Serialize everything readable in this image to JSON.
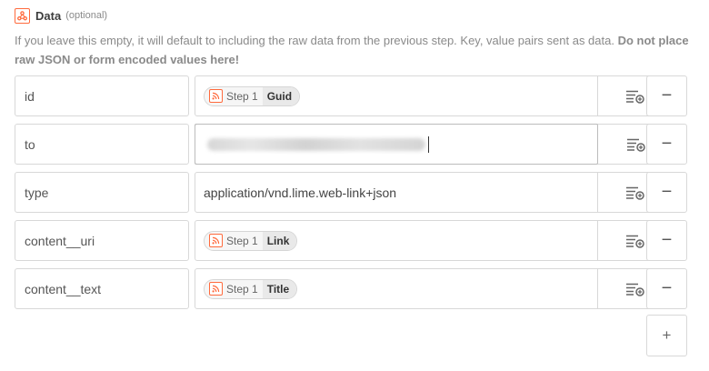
{
  "section": {
    "title": "Data",
    "optional": "(optional)",
    "help_normal": "If you leave this empty, it will default to including the raw data from the previous step. Key, value pairs sent as data.",
    "help_bold": "Do not place raw JSON or form encoded values here!"
  },
  "rows": [
    {
      "key": "id",
      "value_type": "pill",
      "step": "Step 1",
      "field": "Guid"
    },
    {
      "key": "to",
      "value_type": "redacted",
      "value": ""
    },
    {
      "key": "type",
      "value_type": "text",
      "value": "application/vnd.lime.web-link+json"
    },
    {
      "key": "content__uri",
      "value_type": "pill",
      "step": "Step 1",
      "field": "Link"
    },
    {
      "key": "content__text",
      "value_type": "pill",
      "step": "Step 1",
      "field": "Title"
    }
  ],
  "buttons": {
    "remove_label": "−",
    "add_label": "+"
  },
  "icons": {
    "section": "webhook-icon",
    "pill": "rss-icon",
    "insert": "insert-field-icon"
  },
  "colors": {
    "accent": "#ff6a3d",
    "border": "#d8d8d8",
    "muted_text": "#8a8a8a"
  }
}
